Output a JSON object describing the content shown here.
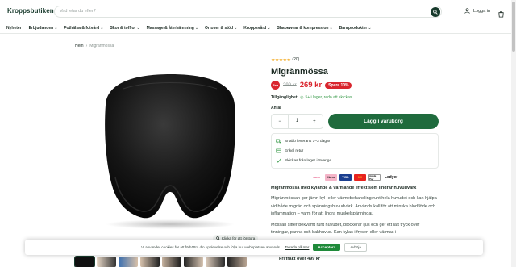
{
  "header": {
    "logo": "Kroppsbutiken",
    "search_placeholder": "Vad letar du efter?",
    "login": "Logga in",
    "search_icon": "search-icon",
    "user_icon": "user-icon",
    "cart_icon": "cart-icon"
  },
  "nav": {
    "items": [
      {
        "label": "Nyheter",
        "chevron": ""
      },
      {
        "label": "Erbjudanden",
        "chevron": "⌄"
      },
      {
        "label": "Fothälsa & fotvård",
        "chevron": "⌄"
      },
      {
        "label": "Skor & tofflor",
        "chevron": "⌄"
      },
      {
        "label": "Massage & återhämtning",
        "chevron": "⌄"
      },
      {
        "label": "Ortoser & stöd",
        "chevron": "⌄"
      },
      {
        "label": "Kroppsvård",
        "chevron": "⌄"
      },
      {
        "label": "Shapewear & kompression",
        "chevron": "⌄"
      },
      {
        "label": "Barnprodukter",
        "chevron": "⌄"
      }
    ]
  },
  "breadcrumb": {
    "home": "Hem",
    "sep": "›",
    "current": "Migränmössa"
  },
  "gallery": {
    "zoom_hint": "Klicka för att förstora",
    "thumb_count": 8
  },
  "product": {
    "rating_stars": "★★★★★",
    "rating_count": "(20)",
    "title": "Migränmössa",
    "badge": "Rea",
    "old_price": "299 kr",
    "price": "269 kr",
    "save": "Spara 10%",
    "stock_label": "Tillgänglighet:",
    "stock_value": "5+ i lager, redo att skickas",
    "qty_label": "Antal",
    "qty_minus": "−",
    "qty_value": "1",
    "qty_plus": "+",
    "add_to_cart": "Lägg i varukorg",
    "usps": [
      "Snabb leverans 1–3 dagar",
      "Enkel retur",
      "Skickas från lager i Sverige"
    ],
    "payments": [
      "Swish",
      "Klarna",
      "VISA",
      "MC",
      "Apple Pay",
      "Ledyer"
    ],
    "desc_heading": "Migränmössa med kylande & värmande effekt som lindrar huvudvärk",
    "desc_p1": "Migränmössan ger jämn kyl- eller värmebehandling runt hela huvudet och kan hjälpa vid både migrän och spänningshuvudvärk. Används kall för att minska blodflöde och inflammation – varm för att lindra muskelspänningar.",
    "desc_p2": "Mössan sitter bekvämt runt huvudet, blockerar ljus och ger ett lätt tryck över tinningar, panna och bakhuvud. Kan kylas i frysen eller värmas i"
  },
  "cookie": {
    "text": "Vi använder cookies för att förbättra din upplevelse och följa hur webbplatsen används.",
    "link": "Ta reda på mer",
    "accept": "Acceptera",
    "deny": "Avböja"
  },
  "sticky": {
    "text": "Fri frakt över 499 kr"
  },
  "colors": {
    "brand": "#173a2c",
    "buy": "#1f6b3d",
    "sale": "#d9262e",
    "star": "#f2a20c"
  }
}
